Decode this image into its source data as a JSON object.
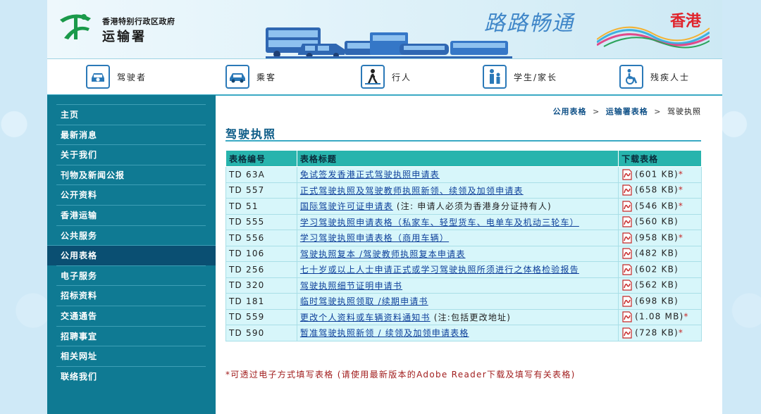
{
  "header": {
    "dept_small": "香港特别行政区政府",
    "dept_name": "运输署",
    "slogan": "路路畅通",
    "hk_brand": "香港"
  },
  "nav": [
    {
      "label": "驾驶者",
      "icon": "car-steering-icon"
    },
    {
      "label": "乘客",
      "icon": "car-icon"
    },
    {
      "label": "行人",
      "icon": "pedestrian-icon"
    },
    {
      "label": "学生/家长",
      "icon": "parent-child-icon"
    },
    {
      "label": "残疾人士",
      "icon": "wheelchair-icon"
    }
  ],
  "sidebar": {
    "items": [
      {
        "label": "主页"
      },
      {
        "label": "最新消息"
      },
      {
        "label": "关于我们"
      },
      {
        "label": "刊物及新闻公报"
      },
      {
        "label": "公开资料"
      },
      {
        "label": "香港运输"
      },
      {
        "label": "公共服务"
      },
      {
        "label": "公用表格"
      },
      {
        "label": "电子服务"
      },
      {
        "label": "招标资料"
      },
      {
        "label": "交通通告"
      },
      {
        "label": "招聘事宜"
      },
      {
        "label": "相关网址"
      },
      {
        "label": "联络我们"
      }
    ],
    "active_index": 7
  },
  "breadcrumb": {
    "items": [
      "公用表格",
      "运输署表格"
    ],
    "current": "驾驶执照",
    "separator": ">"
  },
  "main": {
    "title": "驾驶执照",
    "table": {
      "headers": [
        "表格编号",
        "表格标题",
        "下载表格"
      ],
      "rows": [
        {
          "code": "TD 63A",
          "title": "免试签发香港正式驾驶执照申请表",
          "note": "",
          "size": "(601 KB)",
          "star": "*"
        },
        {
          "code": "TD 557",
          "title": "正式驾驶执照及驾驶教师执照新领、续领及加领申请表",
          "note": "",
          "size": "(658 KB)",
          "star": "*"
        },
        {
          "code": "TD 51",
          "title": "国际驾驶许可证申请表",
          "note": " (注: 申请人必须为香港身分证持有人)",
          "size": "(546 KB)",
          "star": "*"
        },
        {
          "code": "TD 555",
          "title": "学习驾驶执照申请表格（私家车、轻型货车、电单车及机动三轮车）",
          "note": "",
          "size": "(560 KB)",
          "star": ""
        },
        {
          "code": "TD 556",
          "title": "学习驾驶执照申请表格（商用车辆）",
          "note": "",
          "size": "(958 KB)",
          "star": "*"
        },
        {
          "code": "TD 106",
          "title": "驾驶执照复本 /驾驶教师执照复本申请表",
          "note": "",
          "size": "(482 KB)",
          "star": ""
        },
        {
          "code": "TD 256",
          "title": "七十岁或以上人士申请正式或学习驾驶执照所须进行之体格检验报告",
          "note": "",
          "size": "(602 KB)",
          "star": ""
        },
        {
          "code": "TD 320",
          "title": "驾驶执照细节证明申请书",
          "note": "",
          "size": "(562 KB)",
          "star": ""
        },
        {
          "code": "TD 181",
          "title": "临时驾驶执照领取 /续期申请书",
          "note": "",
          "size": "(698 KB)",
          "star": ""
        },
        {
          "code": "TD 559",
          "title": "更改个人资料或车辆资料通知书",
          "note": " (注:包括更改地址)",
          "size": "(1.08 MB)",
          "star": "*"
        },
        {
          "code": "TD 590",
          "title": "暂准驾驶执照新领 / 续领及加领申请表格",
          "note": "",
          "size": "(728 KB)",
          "star": "*"
        }
      ]
    },
    "footnote": "*可透过电子方式填写表格 (请使用最新版本的Adobe Reader下载及填写有关表格)"
  },
  "colors": {
    "sidebar_bg": "#0f7a93",
    "sidebar_active": "#0a4f72",
    "table_header": "#28b4ad",
    "table_row": "#d7f6fa",
    "link": "#0d3f9a",
    "title": "#0a5a86",
    "note_red": "#a11d1d",
    "brand_red": "#e0242c"
  }
}
